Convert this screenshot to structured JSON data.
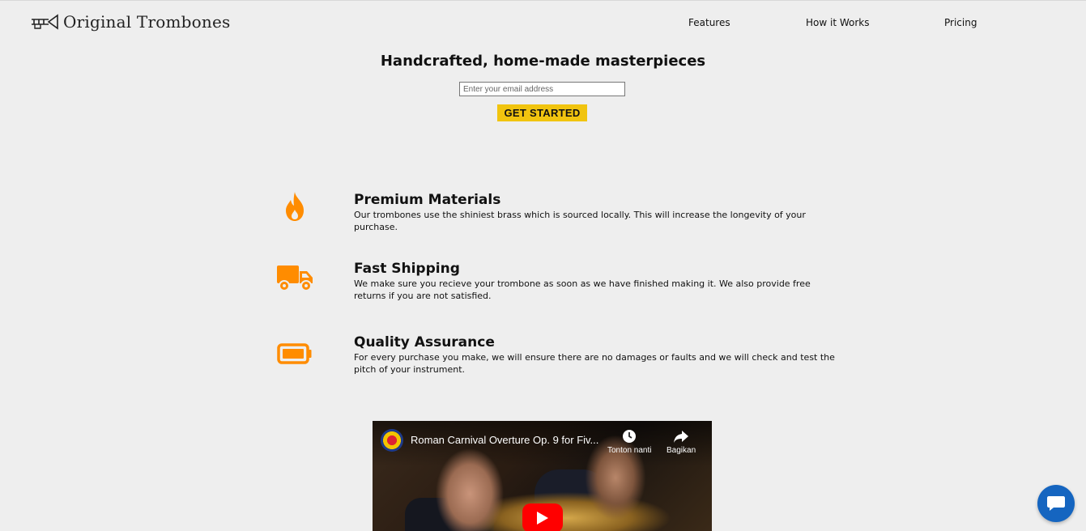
{
  "header": {
    "brand": "Original Trombones",
    "logo_icon": "trombone-icon",
    "nav": [
      {
        "label": "Features"
      },
      {
        "label": "How it Works"
      },
      {
        "label": "Pricing"
      }
    ]
  },
  "hero": {
    "title": "Handcrafted, home-made masterpieces",
    "email_placeholder": "Enter your email address",
    "cta_label": "GET STARTED"
  },
  "features": [
    {
      "icon": "fire-icon",
      "title": "Premium Materials",
      "description": "Our trombones use the shiniest brass which is sourced locally. This will increase the longevity of your purchase."
    },
    {
      "icon": "truck-icon",
      "title": "Fast Shipping",
      "description": "We make sure you recieve your trombone as soon as we have finished making it. We also provide free returns if you are not satisfied."
    },
    {
      "icon": "battery-icon",
      "title": "Quality Assurance",
      "description": "For every purchase you make, we will ensure there are no damages or faults and we will check and test the pitch of your instrument."
    }
  ],
  "video": {
    "title": "Roman Carnival Overture Op. 9 for Fiv...",
    "watch_later": "Tonton nanti",
    "share": "Bagikan"
  },
  "colors": {
    "accent": "#f1c40f",
    "icon_orange": "#ff8c00",
    "background": "#eeeeee",
    "chat": "#1565c0"
  }
}
